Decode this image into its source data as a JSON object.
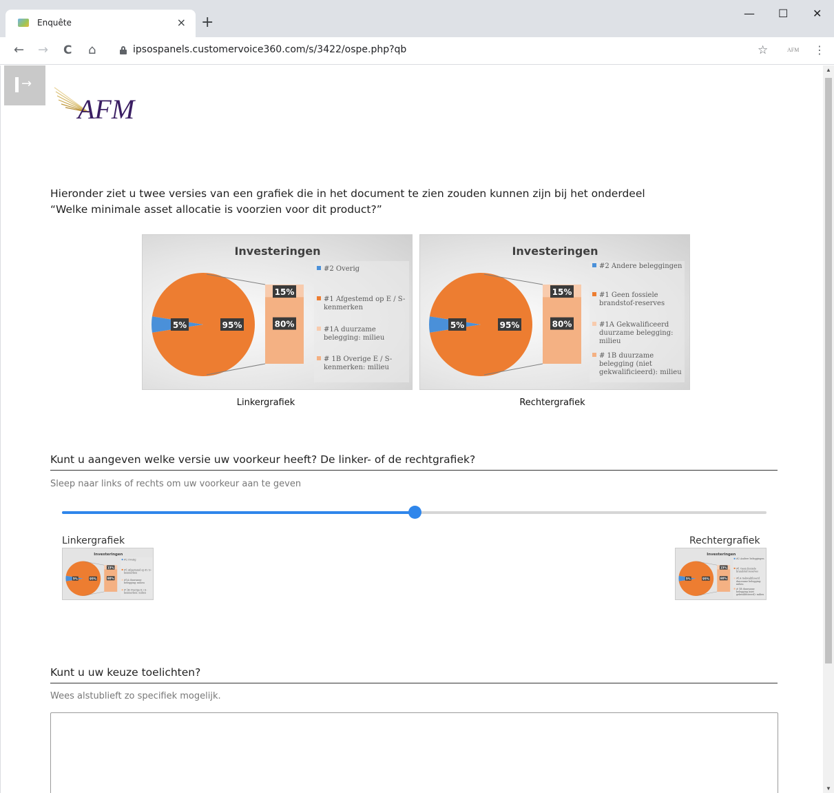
{
  "browser": {
    "tab_title": "Enquête",
    "tab_close": "×",
    "new_tab": "+",
    "url": "ipsospanels.customervoice360.com/s/3422/ospe.php?qb",
    "extension_label": "AFM",
    "win_minimize": "—",
    "win_maximize": "☐",
    "win_close": "✕",
    "back": "←",
    "forward": "→",
    "reload": "C",
    "home": "⌂",
    "star": "☆",
    "menu": "⋮"
  },
  "page": {
    "exit_arrow": "→",
    "logo_text": "AFM",
    "intro_line1": "Hieronder ziet u twee versies van een grafiek die in het document te zien zouden kunnen zijn bij het onderdeel",
    "intro_line2": "“Welke minimale asset allocatie is voorzien voor dit product?”",
    "charts": {
      "left_caption": "Linkergrafiek",
      "right_caption": "Rechtergrafiek"
    },
    "q1": {
      "question": "Kunt u aangeven welke versie uw voorkeur heeft? De linker- of de rechtgrafiek?",
      "hint": "Sleep naar links of rechts om uw voorkeur aan te geven",
      "slider_value": 0.5,
      "left_label": "Linkergrafiek",
      "right_label": "Rechtergrafiek"
    },
    "q2": {
      "question": "Kunt u uw keuze toelichten?",
      "hint": "Wees alstublieft zo specifiek mogelijk.",
      "answer": ""
    }
  },
  "chart_data": [
    {
      "type": "pie",
      "title": "Investeringen",
      "slices": [
        {
          "label": "#2 Overig",
          "value": 5
        },
        {
          "label": "#1 Afgestemd op E / S-kenmerken",
          "value": 95
        }
      ],
      "breakdown": [
        {
          "label": "#1A duurzame belegging: milieu",
          "value": 80
        },
        {
          "label": "# 1B Overige E / S-kenmerken: milieu",
          "value": 15
        }
      ],
      "data_labels": [
        "5%",
        "95%",
        "15%",
        "80%"
      ],
      "legend": [
        "#2 Overig",
        "#1 Afgestemd op E / S-",
        "kenmerken",
        "#1A duurzame",
        "belegging: milieu",
        "# 1B Overige E / S-",
        "kenmerken: milieu"
      ],
      "colors": {
        "overig": "#4a90d9",
        "main": "#ed7d31",
        "light": "#f4b183",
        "light2": "#f8cbad"
      }
    },
    {
      "type": "pie",
      "title": "Investeringen",
      "slices": [
        {
          "label": "#2 Andere beleggingen",
          "value": 5
        },
        {
          "label": "#1 Geen fossiele brandstof-reserves",
          "value": 95
        }
      ],
      "breakdown": [
        {
          "label": "#1A Gekwalificeerd duurzame belegging: milieu",
          "value": 80
        },
        {
          "label": "# 1B duurzame belegging (niet gekwalificieerd): milieu",
          "value": 15
        }
      ],
      "data_labels": [
        "5%",
        "95%",
        "15%",
        "80%"
      ],
      "legend": [
        "#2 Andere beleggingen",
        "#1 Geen fossiele",
        "brandstof-reserves",
        "#1A Gekwalificeerd",
        "duurzame belegging:",
        "milieu",
        "# 1B duurzame",
        "belegging (niet",
        "gekwalificieerd): milieu"
      ],
      "colors": {
        "overig": "#4a90d9",
        "main": "#ed7d31",
        "light": "#f4b183",
        "light2": "#f8cbad"
      }
    }
  ]
}
